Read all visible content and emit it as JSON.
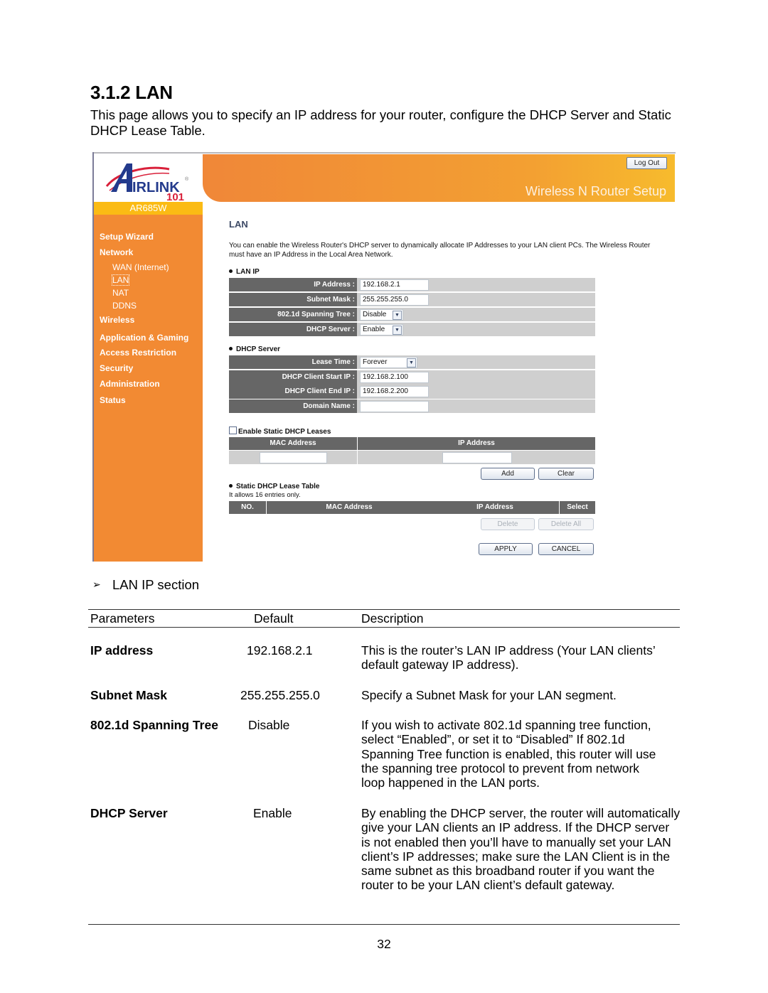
{
  "document": {
    "title": "3.1.2 LAN",
    "intro": "This page allows you to specify an IP address for your router, configure the DHCP Server and Static DHCP Lease Table.",
    "page_number": "32"
  },
  "router_ui": {
    "brand": {
      "logo_text": "IRLINK",
      "logo_number": "101",
      "registered_mark": "®",
      "model": "AR685W"
    },
    "banner_title": "Wireless N Router Setup",
    "logout_label": "Log Out",
    "sidebar": {
      "items": [
        {
          "label": "Setup Wizard",
          "type": "main"
        },
        {
          "label": "Network",
          "type": "main"
        },
        {
          "label": "WAN (Internet)",
          "type": "sub"
        },
        {
          "label": "LAN",
          "type": "sub",
          "active": true
        },
        {
          "label": "NAT",
          "type": "sub"
        },
        {
          "label": "DDNS",
          "type": "sub"
        },
        {
          "label": "Wireless",
          "type": "main"
        },
        {
          "label": "Application & Gaming",
          "type": "main"
        },
        {
          "label": "Access Restriction",
          "type": "main"
        },
        {
          "label": "Security",
          "type": "main"
        },
        {
          "label": "Administration",
          "type": "main"
        },
        {
          "label": "Status",
          "type": "main"
        }
      ]
    },
    "main": {
      "heading": "LAN",
      "description": "You can enable the Wireless Router's DHCP server to dynamically allocate IP Addresses to your LAN client PCs. The Wireless Router must have an IP Address in the Local Area Network.",
      "lan_ip": {
        "section_label": "LAN IP",
        "ip_address": {
          "label": "IP Address :",
          "value": "192.168.2.1"
        },
        "subnet_mask": {
          "label": "Subnet Mask :",
          "value": "255.255.255.0"
        },
        "spanning_tree": {
          "label": "802.1d Spanning Tree :",
          "value": "Disable"
        },
        "dhcp_server": {
          "label": "DHCP Server :",
          "value": "Enable"
        }
      },
      "dhcp_server": {
        "section_label": "DHCP Server",
        "lease_time": {
          "label": "Lease Time :",
          "value": "Forever"
        },
        "start_ip": {
          "label": "DHCP Client Start IP :",
          "value": "192.168.2.100"
        },
        "end_ip": {
          "label": "DHCP Client End IP :",
          "value": "192.168.2.200"
        },
        "domain_name": {
          "label": "Domain Name :",
          "value": ""
        }
      },
      "static_leases": {
        "checkbox_label": "Enable Static DHCP Leases",
        "checked": false,
        "columns": [
          "MAC Address",
          "IP Address"
        ],
        "mac_value": "",
        "ip_value": "",
        "add_label": "Add",
        "clear_label": "Clear"
      },
      "lease_table": {
        "section_label": "Static DHCP Lease Table",
        "note": "It allows 16 entries only.",
        "columns": [
          "NO.",
          "MAC Address",
          "IP Address",
          "Select"
        ],
        "rows": [],
        "delete_label": "Delete",
        "delete_all_label": "Delete All"
      },
      "apply_label": "APPLY",
      "cancel_label": "CANCEL"
    }
  },
  "lan_ip_section": {
    "heading": "LAN IP section",
    "columns": [
      "Parameters",
      "Default",
      "Description"
    ],
    "rows": [
      {
        "parameter": "IP address",
        "default": "192.168.2.1",
        "description": "This is the router’s LAN IP address (Your LAN clients’ default gateway IP address)."
      },
      {
        "parameter": "Subnet Mask",
        "default": "255.255.255.0",
        "description": "Specify a Subnet Mask for your LAN segment."
      },
      {
        "parameter": "802.1d Spanning Tree",
        "default": "Disable",
        "description": "If you wish to activate 802.1d spanning tree function, select “Enabled”, or set it to “Disabled” If 802.1d Spanning Tree function is enabled, this router will use the spanning tree protocol to prevent from network loop happened in the LAN ports."
      },
      {
        "parameter": "DHCP Server",
        "default": "Enable",
        "description": "By enabling the DHCP server, the router will automatically give your LAN clients an IP address. If the DHCP server is not enabled then you’ll have to manually set your LAN client’s IP addresses; make sure the LAN Client is in the same subnet as this broadband router if you want the router to be your LAN client’s default gateway."
      }
    ]
  }
}
